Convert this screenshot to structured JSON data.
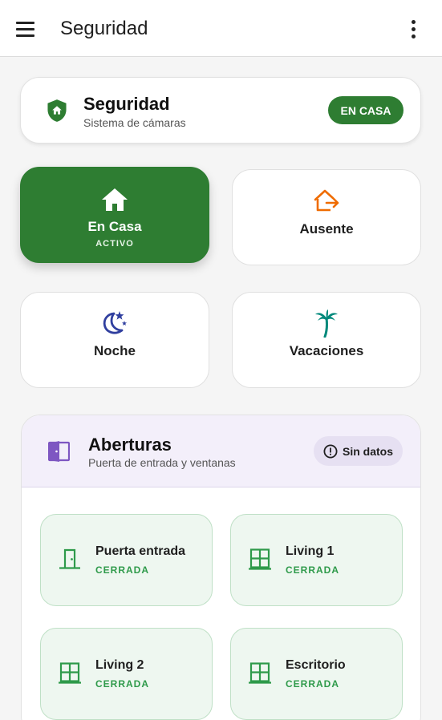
{
  "appbar": {
    "title": "Seguridad",
    "menu_icon": "menu-icon",
    "more_icon": "more-vert-icon"
  },
  "header": {
    "title": "Seguridad",
    "subtitle": "Sistema de cámaras",
    "status_badge": "EN CASA",
    "icon": "shield-home-icon"
  },
  "modes": [
    {
      "label": "En Casa",
      "sublabel": "ACTIVO",
      "icon": "home-icon",
      "active": true
    },
    {
      "label": "Ausente",
      "icon": "home-export-icon",
      "active": false
    },
    {
      "label": "Noche",
      "icon": "moon-stars-icon",
      "active": false
    },
    {
      "label": "Vacaciones",
      "icon": "palm-tree-icon",
      "active": false
    }
  ],
  "aberturas": {
    "title": "Aberturas",
    "subtitle": "Puerta de entrada y ventanas",
    "badge": "Sin datos",
    "badge_icon": "alert-circle-icon",
    "sensors": [
      {
        "name": "Puerta entrada",
        "state": "CERRADA",
        "icon": "door-closed-icon"
      },
      {
        "name": "Living 1",
        "state": "CERRADA",
        "icon": "window-closed-icon"
      },
      {
        "name": "Living 2",
        "state": "CERRADA",
        "icon": "window-closed-icon"
      },
      {
        "name": "Escritorio",
        "state": "CERRADA",
        "icon": "window-closed-icon"
      }
    ]
  },
  "colors": {
    "primary_green": "#2e7d32",
    "orange": "#ef6c00",
    "indigo": "#303f9f",
    "teal": "#00897b",
    "purple": "#7e57c2",
    "closed_green": "#2e9a4a"
  }
}
